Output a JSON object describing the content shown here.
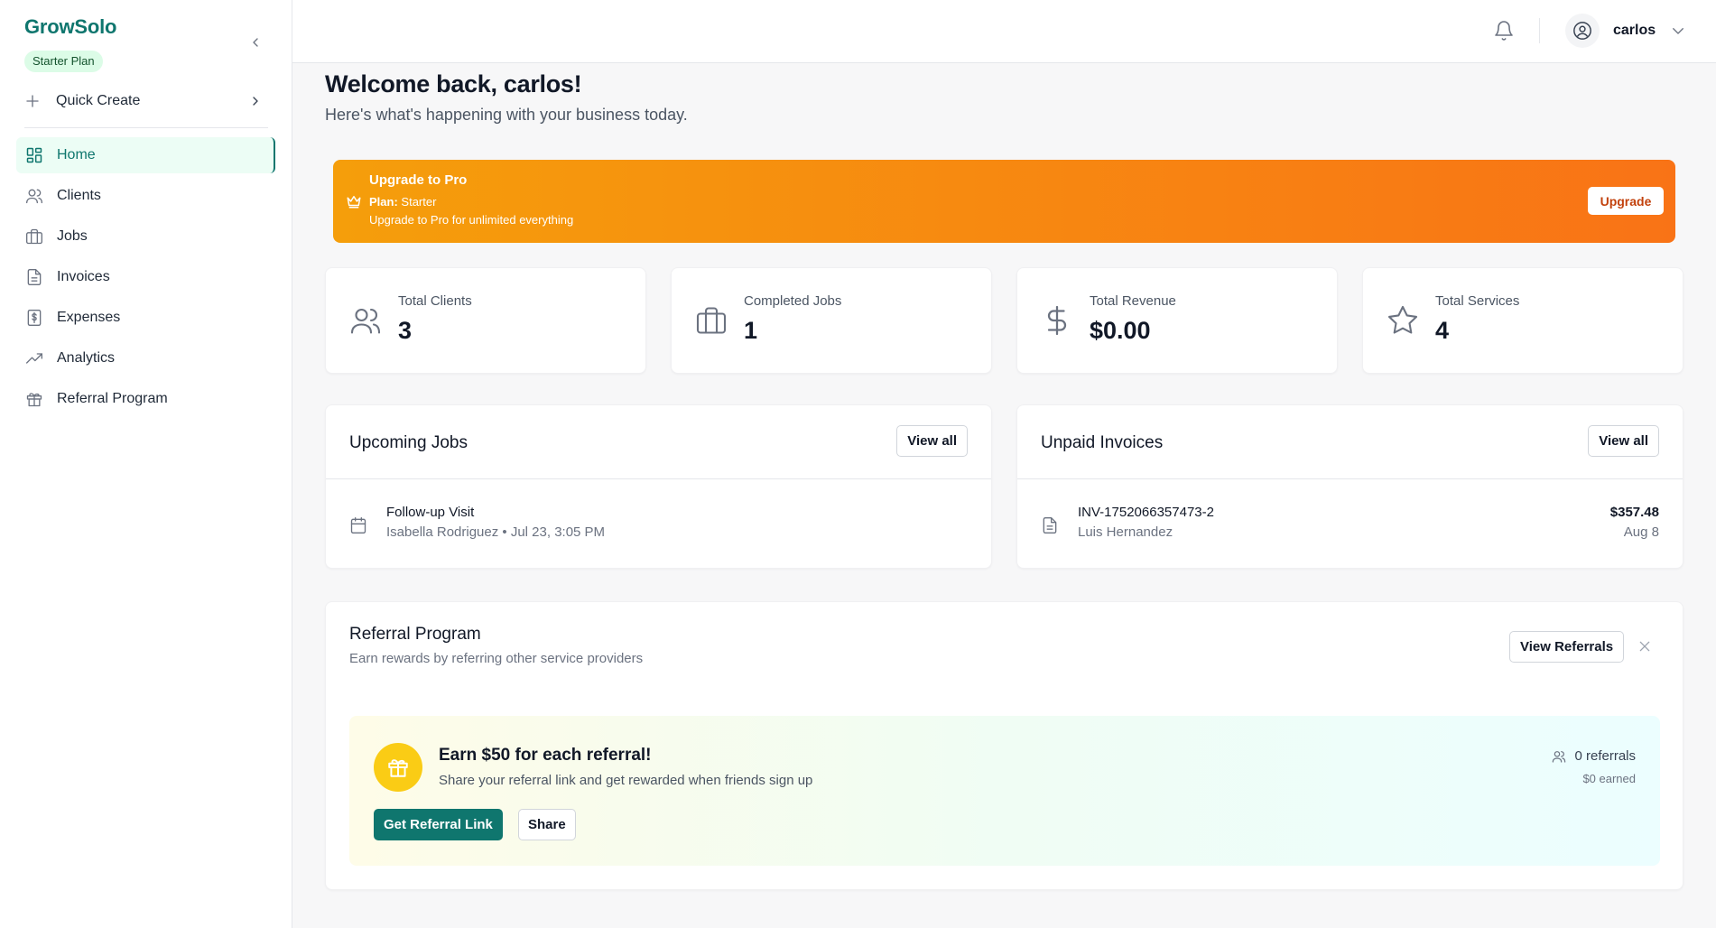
{
  "sidebar": {
    "brand": "GrowSolo",
    "plan_badge": "Starter Plan",
    "quick_create": "Quick Create",
    "items": [
      {
        "label": "Home",
        "icon": "grid-icon",
        "active": true
      },
      {
        "label": "Clients",
        "icon": "users-icon"
      },
      {
        "label": "Jobs",
        "icon": "briefcase-icon"
      },
      {
        "label": "Invoices",
        "icon": "document-icon"
      },
      {
        "label": "Expenses",
        "icon": "receipt-icon"
      },
      {
        "label": "Analytics",
        "icon": "trending-up-icon"
      },
      {
        "label": "Referral Program",
        "icon": "gift-icon"
      }
    ]
  },
  "topbar": {
    "username": "carlos"
  },
  "welcome": {
    "title": "Welcome back, carlos!",
    "subtitle": "Here's what's happening with your business today."
  },
  "upgrade": {
    "title": "Upgrade to Pro",
    "plan_label": "Plan:",
    "plan_value": "Starter",
    "description": "Upgrade to Pro for unlimited everything",
    "button": "Upgrade"
  },
  "stats": [
    {
      "label": "Total Clients",
      "value": "3",
      "icon": "users-icon"
    },
    {
      "label": "Completed Jobs",
      "value": "1",
      "icon": "briefcase-icon"
    },
    {
      "label": "Total Revenue",
      "value": "$0.00",
      "icon": "dollar-icon"
    },
    {
      "label": "Total Services",
      "value": "4",
      "icon": "star-icon"
    }
  ],
  "upcoming_jobs": {
    "title": "Upcoming Jobs",
    "view_all": "View all",
    "items": [
      {
        "title": "Follow-up Visit",
        "subtitle": "Isabella Rodriguez • Jul 23, 3:05 PM"
      }
    ]
  },
  "unpaid_invoices": {
    "title": "Unpaid Invoices",
    "view_all": "View all",
    "items": [
      {
        "number": "INV-1752066357473-2",
        "client": "Luis Hernandez",
        "amount": "$357.48",
        "date": "Aug 8"
      }
    ]
  },
  "referral": {
    "title": "Referral Program",
    "subtitle": "Earn rewards by referring other service providers",
    "view_button": "View Referrals",
    "card_title": "Earn $50 for each referral!",
    "card_desc": "Share your referral link and get rewarded when friends sign up",
    "get_link": "Get Referral Link",
    "share": "Share",
    "count": "0 referrals",
    "earned": "$0 earned"
  },
  "colors": {
    "brand": "#0f766e",
    "upgrade_start": "#f59e0b",
    "upgrade_end": "#f97316"
  }
}
